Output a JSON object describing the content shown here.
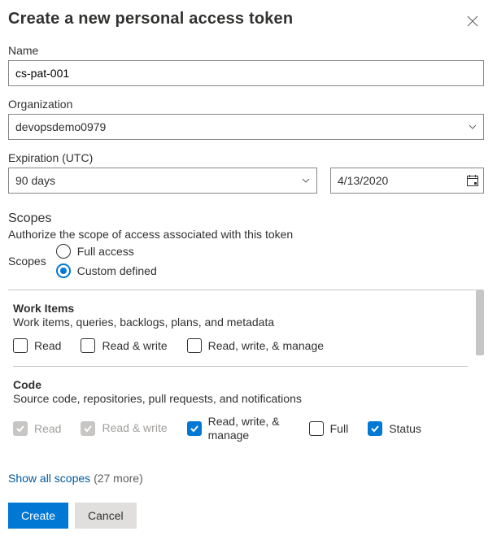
{
  "dialog": {
    "title": "Create a new personal access token"
  },
  "fields": {
    "name_label": "Name",
    "name_value": "cs-pat-001",
    "org_label": "Organization",
    "org_value": "devopsdemo0979",
    "expiration_label": "Expiration (UTC)",
    "expiration_duration": "90 days",
    "expiration_date": "4/13/2020"
  },
  "scopes": {
    "heading": "Scopes",
    "description": "Authorize the scope of access associated with this token",
    "label": "Scopes",
    "options": {
      "full": "Full access",
      "custom": "Custom defined"
    },
    "selected": "custom"
  },
  "scope_groups": [
    {
      "id": "work-items",
      "title": "Work Items",
      "desc": "Work items, queries, backlogs, plans, and metadata",
      "perms": [
        {
          "label": "Read",
          "checked": false,
          "disabled": false
        },
        {
          "label": "Read & write",
          "checked": false,
          "disabled": false
        },
        {
          "label": "Read, write, & manage",
          "checked": false,
          "disabled": false
        }
      ]
    },
    {
      "id": "code",
      "title": "Code",
      "desc": "Source code, repositories, pull requests, and notifications",
      "perms": [
        {
          "label": "Read",
          "checked": true,
          "disabled": true
        },
        {
          "label": "Read & write",
          "checked": true,
          "disabled": true,
          "multiline": true
        },
        {
          "label": "Read, write, & manage",
          "checked": true,
          "disabled": false,
          "multiline": true
        },
        {
          "label": "Full",
          "checked": false,
          "disabled": false
        },
        {
          "label": "Status",
          "checked": true,
          "disabled": false
        }
      ]
    }
  ],
  "show_all": {
    "link": "Show all scopes",
    "count": "(27 more)"
  },
  "footer": {
    "create": "Create",
    "cancel": "Cancel"
  }
}
